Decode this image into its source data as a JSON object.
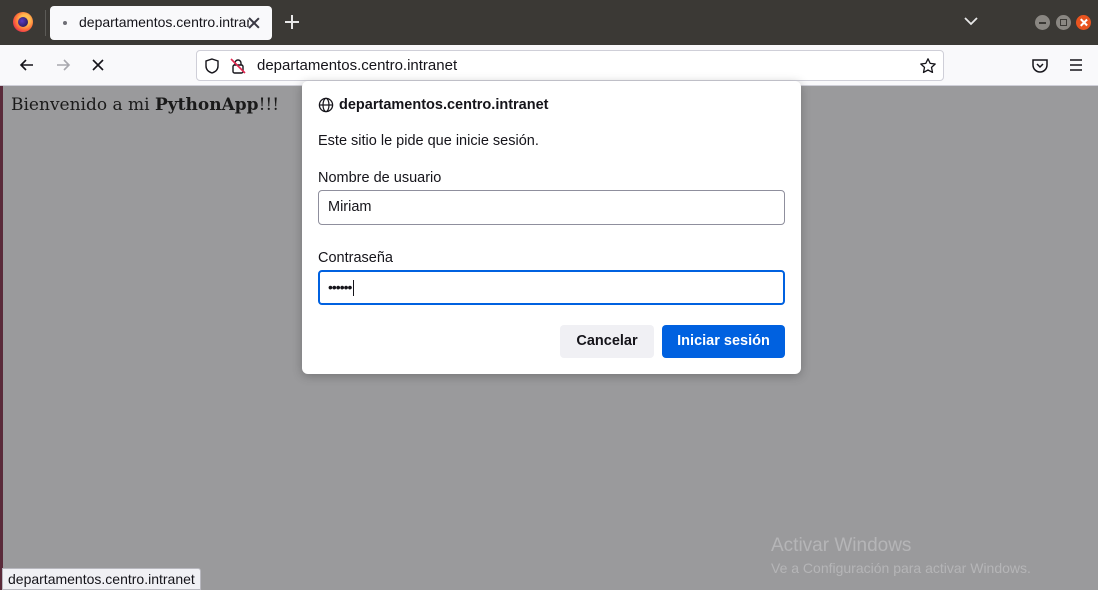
{
  "tab": {
    "title": "departamentos.centro.intranet"
  },
  "urlbar": {
    "url": "departamentos.centro.intranet"
  },
  "page": {
    "welcome_prefix": "Bienvenido a mi ",
    "welcome_app": "PythonApp",
    "welcome_suffix": "!!!"
  },
  "dialog": {
    "host": "departamentos.centro.intranet",
    "message": "Este sitio le pide que inicie sesión.",
    "username_label": "Nombre de usuario",
    "username_value": "Miriam",
    "password_label": "Contraseña",
    "password_value": "••••••",
    "cancel_label": "Cancelar",
    "ok_label": "Iniciar sesión"
  },
  "watermark": {
    "line1": "Activar Windows",
    "line2": "Ve a Configuración para activar Windows."
  },
  "statusbar": {
    "text": "departamentos.centro.intranet"
  },
  "colors": {
    "accent": "#0061e0",
    "tabstrip": "#3b3935",
    "overlay": "#9a9a9c"
  }
}
